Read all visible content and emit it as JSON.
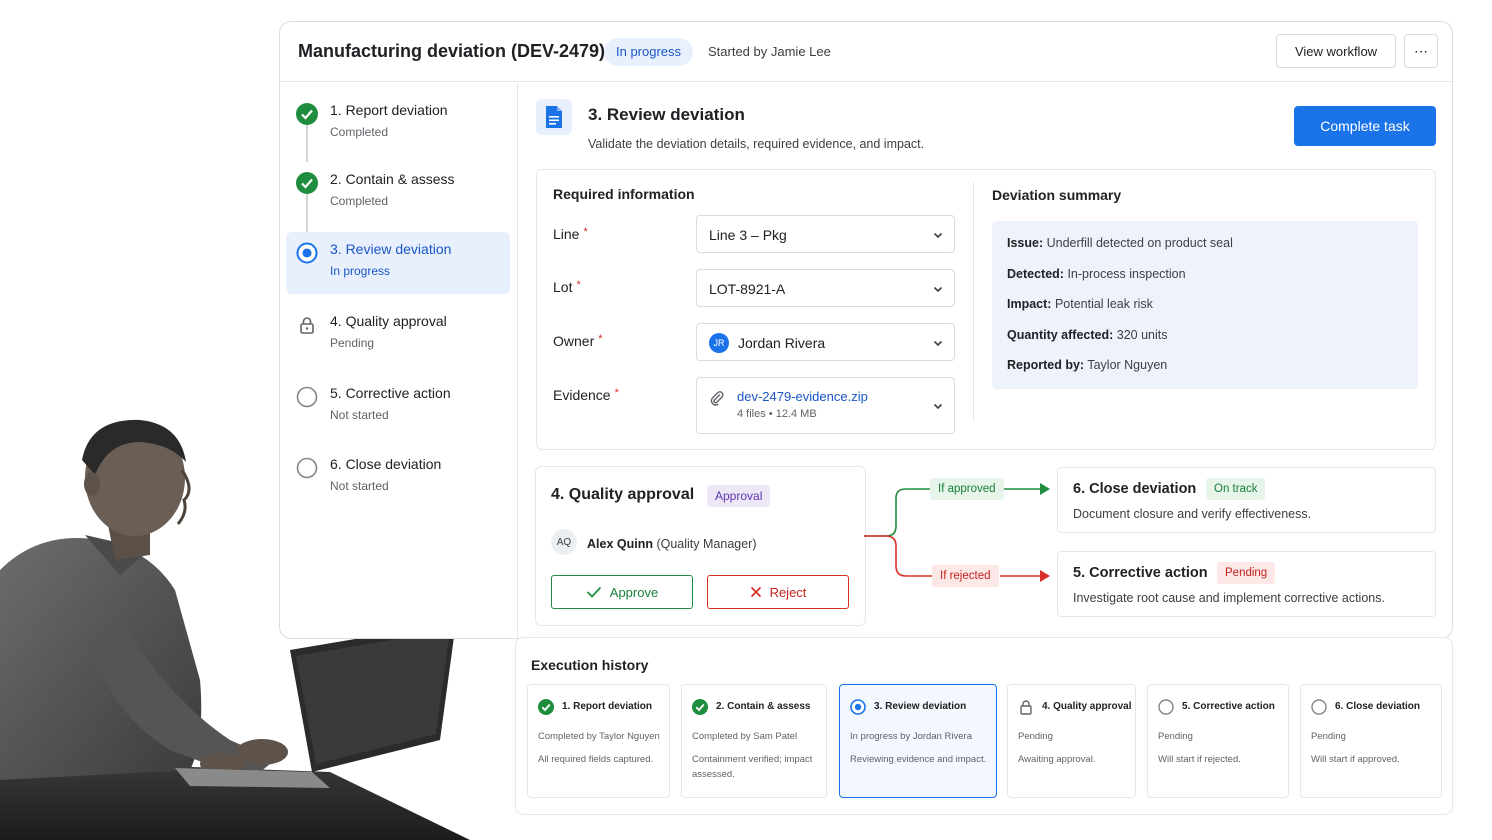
{
  "header": {
    "title": "Manufacturing deviation (DEV-2479)",
    "status": "In progress",
    "started_by": "Started by Jamie Lee",
    "view_workflow": "View workflow",
    "more": "⋯"
  },
  "steps": [
    {
      "label": "1. Report deviation",
      "status": "Completed",
      "state": "done"
    },
    {
      "label": "2. Contain & assess",
      "status": "Completed",
      "state": "done"
    },
    {
      "label": "3. Review deviation",
      "status": "In progress",
      "state": "active"
    },
    {
      "label": "4. Quality approval",
      "status": "Pending",
      "state": "locked"
    },
    {
      "label": "5. Corrective action",
      "status": "Not started",
      "state": "todo"
    },
    {
      "label": "6. Close deviation",
      "status": "Not started",
      "state": "todo"
    }
  ],
  "review": {
    "title": "3. Review deviation",
    "subtitle": "Validate the deviation details, required evidence, and impact.",
    "complete_button": "Complete task"
  },
  "required": {
    "heading": "Required information",
    "required_mark": "*",
    "line": {
      "label": "Line",
      "value": "Line 3 – Pkg"
    },
    "lot": {
      "label": "Lot",
      "value": "LOT-8921-A"
    },
    "owner": {
      "label": "Owner",
      "value": "Jordan Rivera",
      "initials": "JR"
    },
    "evidence": {
      "label": "Evidence",
      "file": "dev-2479-evidence.zip",
      "meta": "4 files • 12.4 MB"
    }
  },
  "summary": {
    "heading": "Deviation summary",
    "rows": [
      {
        "key": "Issue:",
        "value": "Underfill detected on product seal"
      },
      {
        "key": "Detected:",
        "value": "In-process inspection"
      },
      {
        "key": "Impact:",
        "value": "Potential leak risk"
      },
      {
        "key": "Quantity affected:",
        "value": "320 units"
      },
      {
        "key": "Reported by:",
        "value": "Taylor Nguyen"
      }
    ]
  },
  "approval": {
    "title": "4. Quality approval",
    "badge": "Approval",
    "approver_initials": "AQ",
    "approver_name": "Alex Quinn",
    "approver_role": "(Quality Manager)",
    "approve": "Approve",
    "reject": "Reject"
  },
  "branches": {
    "approved_label": "If approved",
    "rejected_label": "If rejected",
    "close": {
      "title": "6. Close deviation",
      "badge": "On track",
      "desc": "Document closure and verify effectiveness."
    },
    "corrective": {
      "title": "5. Corrective action",
      "badge": "Pending",
      "desc": "Investigate root cause and implement corrective actions."
    }
  },
  "history": {
    "title": "Execution history",
    "cards": [
      {
        "title": "1. Report deviation",
        "line1": "Completed by Taylor Nguyen",
        "line2": "All required fields captured.",
        "state": "done"
      },
      {
        "title": "2. Contain & assess",
        "line1": "Completed by Sam Patel",
        "line2": "Containment verified; impact assessed.",
        "state": "done"
      },
      {
        "title": "3. Review deviation",
        "line1": "In progress by Jordan Rivera",
        "line2": "Reviewing evidence and impact.",
        "state": "active"
      },
      {
        "title": "4. Quality approval",
        "line1": "Pending",
        "line2": "Awaiting approval.",
        "state": "locked"
      },
      {
        "title": "5. Corrective action",
        "line1": "Pending",
        "line2": "Will start if rejected.",
        "state": "todo"
      },
      {
        "title": "6. Close deviation",
        "line1": "Pending",
        "line2": "Will start if approved.",
        "state": "todo"
      }
    ]
  },
  "colors": {
    "primary": "#1a73e8",
    "success": "#1e8e3e",
    "danger": "#d93025",
    "accent_purple": "#5e35b1"
  }
}
